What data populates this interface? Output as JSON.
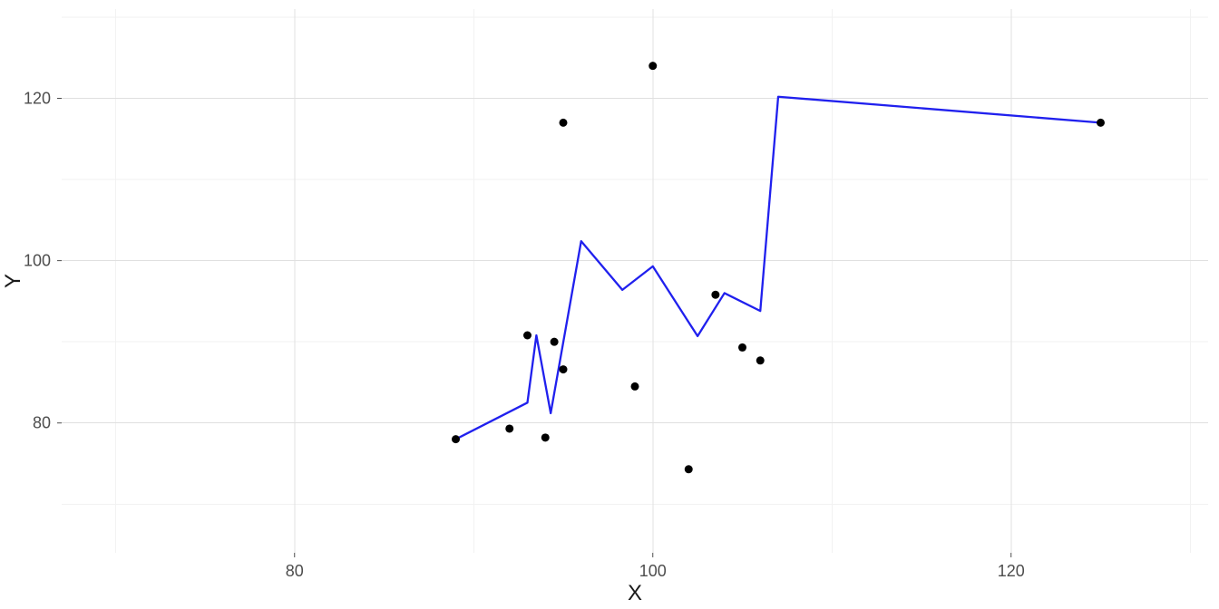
{
  "chart_data": {
    "type": "scatter",
    "title": "",
    "xlabel": "X",
    "ylabel": "Y",
    "xlim": [
      67,
      131
    ],
    "ylim": [
      64,
      131
    ],
    "x_ticks": [
      80,
      100,
      120
    ],
    "y_ticks": [
      80,
      100,
      120
    ],
    "x_minor": [
      70,
      90,
      110,
      130
    ],
    "y_minor": [
      70,
      90,
      110,
      130
    ],
    "scatter": [
      {
        "x": 89,
        "y": 78
      },
      {
        "x": 92,
        "y": 79.3
      },
      {
        "x": 93,
        "y": 90.8
      },
      {
        "x": 94,
        "y": 78.2
      },
      {
        "x": 94.5,
        "y": 90
      },
      {
        "x": 95,
        "y": 86.6
      },
      {
        "x": 95,
        "y": 117
      },
      {
        "x": 99,
        "y": 84.5
      },
      {
        "x": 100,
        "y": 124
      },
      {
        "x": 102,
        "y": 74.3
      },
      {
        "x": 103.5,
        "y": 95.8
      },
      {
        "x": 105,
        "y": 89.3
      },
      {
        "x": 106,
        "y": 87.7
      },
      {
        "x": 125,
        "y": 117
      }
    ],
    "line": [
      {
        "x": 89,
        "y": 78
      },
      {
        "x": 93,
        "y": 82.5
      },
      {
        "x": 93.5,
        "y": 90.8
      },
      {
        "x": 94.3,
        "y": 81.2
      },
      {
        "x": 96,
        "y": 102.4
      },
      {
        "x": 98.3,
        "y": 96.4
      },
      {
        "x": 100,
        "y": 99.3
      },
      {
        "x": 102.5,
        "y": 90.7
      },
      {
        "x": 104,
        "y": 96
      },
      {
        "x": 106,
        "y": 93.8
      },
      {
        "x": 107,
        "y": 120.2
      },
      {
        "x": 125,
        "y": 117
      }
    ]
  }
}
